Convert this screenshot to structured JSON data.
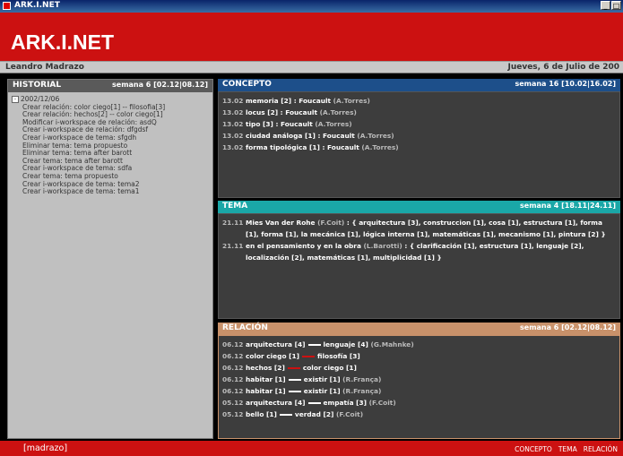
{
  "window": {
    "title": "ARK.I.NET",
    "buttons": [
      "_",
      "□"
    ]
  },
  "brand": {
    "name": "ARK.I.NET"
  },
  "userbar": {
    "user": "Leandro Madrazo",
    "date": "Jueves, 6 de Julio de 200"
  },
  "historial": {
    "title": "HISTORIAL",
    "week": "semana 6 [02.12|08.12]",
    "date": "2002/12/06",
    "items": [
      "Crear relación: color ciego[1] -- filosofia[3]",
      "Crear relación: hechos[2] -- color ciego[1]",
      "Modificar i-workspace de relación: asdQ",
      "Crear i-workspace de relación: dfgdsf",
      "Crear i-workspace de tema: sfgdh",
      "Eliminar tema: tema propuesto",
      "Eliminar tema: tema after barott",
      "Crear tema: tema after barott",
      "Crear i-workspace de tema: sdfa",
      "Crear tema: tema propuesto",
      "Crear i-workspace de tema: tema2",
      "Crear i-workspace de tema: tema1"
    ]
  },
  "concepto": {
    "title": "CONCEPTO",
    "week": "semana 16 [10.02|16.02]",
    "rows": [
      {
        "date": "13.02",
        "term": "memoria [2]",
        "sep": ":",
        "ref": "Foucault",
        "author": "(A.Torres)"
      },
      {
        "date": "13.02",
        "term": "locus [2]",
        "sep": ":",
        "ref": "Foucault",
        "author": "(A.Torres)"
      },
      {
        "date": "13.02",
        "term": "tipo [3]",
        "sep": ":",
        "ref": "Foucault",
        "author": "(A.Torres)"
      },
      {
        "date": "13.02",
        "term": "ciudad análoga [1]",
        "sep": ":",
        "ref": "Foucault",
        "author": "(A.Torres)"
      },
      {
        "date": "13.02",
        "term": "forma tipológica [1]",
        "sep": ":",
        "ref": "Foucault",
        "author": "(A.Torres)"
      }
    ]
  },
  "tema": {
    "title": "TEMA",
    "week": "semana 4 [18.11|24.11]",
    "rows": [
      {
        "date": "21.11",
        "name": "Mies Van der Rohe",
        "author": "(F.Coit)",
        "terms": ": { arquitectura [3], construccion [1], cosa [1], estructura [1], forma [1], forma [1], la mecánica [1], lógica interna [1], matemáticas [1], mecanismo [1], pintura [2] }"
      },
      {
        "date": "21.11",
        "name": "en el pensamiento y en la obra",
        "author": "(L.Barotti)",
        "terms": ": { clarificación [1], estructura [1], lenguaje [2], localización [2], matemáticas [1], multiplicidad [1] }"
      }
    ]
  },
  "relacion": {
    "title": "RELACIÓN",
    "week": "semana 6 [02.12|08.12]",
    "rows": [
      {
        "date": "06.12",
        "a": "arquitectura [4]",
        "b": "lenguaje [4]",
        "author": "(G.Mahnke)",
        "red": false
      },
      {
        "date": "06.12",
        "a": "color ciego [1]",
        "b": "filosofía [3]",
        "author": "",
        "red": true
      },
      {
        "date": "06.12",
        "a": "hechos [2]",
        "b": "color ciego [1]",
        "author": "",
        "red": true
      },
      {
        "date": "06.12",
        "a": "habitar [1]",
        "b": "existir [1]",
        "author": "(R.França)",
        "red": false
      },
      {
        "date": "06.12",
        "a": "habitar [1]",
        "b": "existir [1]",
        "author": "(R.França)",
        "red": false
      },
      {
        "date": "05.12",
        "a": "arquitectura [4]",
        "b": "empatía [3]",
        "author": "(F.Coit)",
        "red": false
      },
      {
        "date": "05.12",
        "a": "bello [1]",
        "b": "verdad [2]",
        "author": "(F.Coit)",
        "red": false
      }
    ]
  },
  "footer": {
    "user": "[madrazo]",
    "links": [
      "CONCEPTO",
      "TEMA",
      "RELACIÓN"
    ]
  },
  "colors": {
    "brand_red": "#cc1111",
    "concepto": "#1d4f8a",
    "tema": "#1aa7a7",
    "relacion": "#c8916a"
  }
}
